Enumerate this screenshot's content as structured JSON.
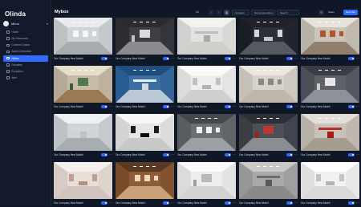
{
  "app": {
    "logo": "Olinda"
  },
  "user": {
    "name": "Mirus"
  },
  "sidebar": {
    "items": [
      {
        "label": "Home",
        "active": false
      },
      {
        "label": "My Showroom",
        "active": false
      },
      {
        "label": "Content Creator",
        "active": false
      },
      {
        "label": "Asset Generation",
        "active": false
      },
      {
        "label": "Mybox",
        "active": true
      },
      {
        "label": "Favorites",
        "active": false
      },
      {
        "label": "Exception",
        "active": false
      },
      {
        "label": "Alert",
        "active": false
      }
    ]
  },
  "header": {
    "title": "Mybox",
    "filter_all": "All",
    "select_1": "Contains",
    "select_2": "Name Ascending",
    "select_3": "Search",
    "share_label": "Share",
    "new_label": "New File"
  },
  "cards": [
    {
      "title": "Our Company New Model",
      "theme": "white-gallery"
    },
    {
      "title": "Our Company New Model",
      "theme": "dark-hall"
    },
    {
      "title": "Our Company New Model",
      "theme": "minimal-room"
    },
    {
      "title": "Our Company New Model",
      "theme": "dark-spheres"
    },
    {
      "title": "Our Company New Model",
      "theme": "warm-gallery"
    },
    {
      "title": "Our Company New Model",
      "theme": "wood-room"
    },
    {
      "title": "Our Company New Model",
      "theme": "blue-dome"
    },
    {
      "title": "Our Company New Model",
      "theme": "white-arcade"
    },
    {
      "title": "Our Company New Model",
      "theme": "grey-loft"
    },
    {
      "title": "Our Company New Model",
      "theme": "dark-cube"
    },
    {
      "title": "Our Company New Model",
      "theme": "light-hall"
    },
    {
      "title": "Our Company New Model",
      "theme": "frames-room"
    },
    {
      "title": "Our Company New Model",
      "theme": "dark-corridor"
    },
    {
      "title": "Our Company New Model",
      "theme": "grey-warehouse"
    },
    {
      "title": "Our Company New Model",
      "theme": "red-gallery"
    },
    {
      "title": "Our Company New Model",
      "theme": "pink-room"
    },
    {
      "title": "Our Company New Model",
      "theme": "warm-loft"
    },
    {
      "title": "Our Company New Model",
      "theme": "white-showroom"
    },
    {
      "title": "Our Company New Model",
      "theme": "concrete-room"
    },
    {
      "title": "Our Company New Model",
      "theme": "white-bright"
    }
  ],
  "colors": {
    "accent": "#2f6bff",
    "background": "#101827",
    "sidebar": "#121a2b"
  }
}
